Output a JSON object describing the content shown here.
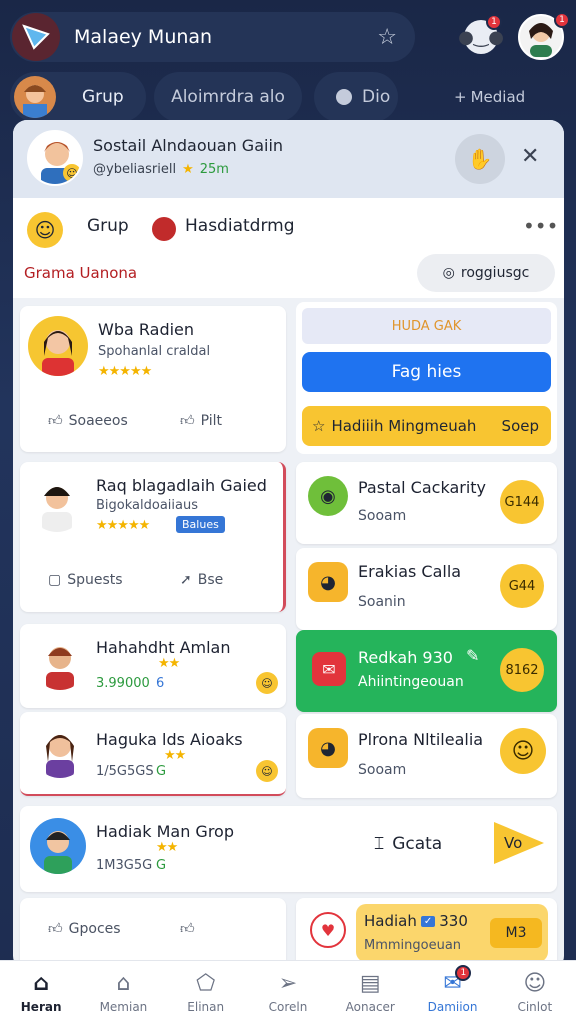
{
  "app": {
    "title": "Malaey Munan",
    "notif_count": "1",
    "profile_badge": "1"
  },
  "chips": {
    "group": "Grup",
    "middle": "Aloimrdra alo",
    "right_chip": "Dio",
    "added": "Mediad"
  },
  "header": {
    "title": "Sostail Alndaouan Gaiin",
    "subtitle": "@ybeliasriell",
    "time": "25m"
  },
  "group_row": {
    "group": "Grup",
    "member": "Hasdiatdrmg",
    "link_label": "Grama Uanona",
    "button": "roggiusgc"
  },
  "left_tiles": [
    {
      "title": "Wba Radien",
      "sub": "Spohanlal craldal",
      "stars": "★★★★★",
      "act1": "Soaeeos",
      "act2": "Pilt"
    },
    {
      "title": "Raq blagadlaih Gaied",
      "sub": "Bigokaldoaiiaus",
      "stars": "★★★★★",
      "badge": "Balues",
      "act1": "Spuests",
      "act2": "Bse"
    },
    {
      "title": "Hahahdht Amlan",
      "stars": "★★",
      "count": "3.99000",
      "score": "6"
    },
    {
      "title": "Haguka lds Aioaks",
      "stars": "★★",
      "count": "1/5G5GS",
      "score": "G"
    },
    {
      "title": "Hadiak Man Grop",
      "stars": "★★",
      "count": "1M3G5G",
      "score": "G",
      "right_label": "Gcata",
      "arrow_label": "Vo"
    },
    {
      "act1": "Gpoces"
    }
  ],
  "right_panel": {
    "field": "HUDA GAK",
    "primary_button": "Fag hies",
    "secondary_button": "Hadiiih Mingmeuah",
    "secondary_extra": "Soep"
  },
  "right_tiles": [
    {
      "title": "Pastal Cackarity",
      "sub": "Sooam",
      "value": "G144"
    },
    {
      "title": "Erakias Calla",
      "sub": "Soanin",
      "value": "G44"
    },
    {
      "title": "Redkah 930",
      "sub": "Ahiintingeouan",
      "value": "8162"
    },
    {
      "title": "Plrona Nltilealia",
      "sub": "Sooam"
    },
    {
      "title": "Hadiah",
      "num": "330",
      "sub": "Mmmingoeuan",
      "value": "M3"
    }
  ],
  "nav": [
    {
      "label": "Heran",
      "icon": "home-icon"
    },
    {
      "label": "Memian",
      "icon": "house-outline-icon"
    },
    {
      "label": "Elinan",
      "icon": "pentagon-icon"
    },
    {
      "label": "Coreln",
      "icon": "send-icon"
    },
    {
      "label": "Aonacer",
      "icon": "document-icon"
    },
    {
      "label": "Damiion",
      "icon": "mail-icon",
      "badge": "1"
    },
    {
      "label": "Cinlot",
      "icon": "user-icon"
    }
  ]
}
